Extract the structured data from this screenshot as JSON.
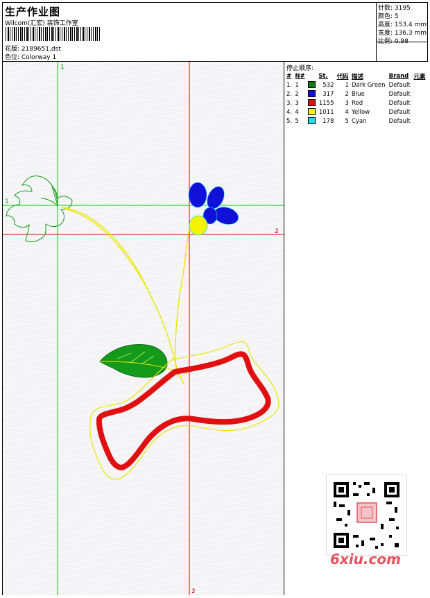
{
  "header": {
    "title": "生产作业图",
    "company": "Wilcom(汇宏) 装饰工作室",
    "design_label": "花版: 2189651.dst",
    "colorway_label": "色位: Colorway 1"
  },
  "stats": {
    "stitches": "针数: 3195",
    "colors": "颜色: 5",
    "height": "高度: 153.4 mm",
    "width": "宽度: 136.3 mm",
    "scale": "比例: 0.98"
  },
  "stop_sequence": {
    "title": "停止顺序:",
    "columns": [
      "#",
      "N#",
      "St.",
      "代码",
      "描述",
      "Brand",
      "元素"
    ],
    "rows": [
      {
        "idx": "1.",
        "n": "1",
        "color": "#0e7c12",
        "st": "532",
        "code": "1",
        "desc": "Dark Green",
        "brand": "Default"
      },
      {
        "idx": "2.",
        "n": "2",
        "color": "#1010d8",
        "st": "317",
        "code": "2",
        "desc": "Blue",
        "brand": "Default"
      },
      {
        "idx": "3.",
        "n": "3",
        "color": "#e01010",
        "st": "1155",
        "code": "3",
        "desc": "Red",
        "brand": "Default"
      },
      {
        "idx": "4.",
        "n": "4",
        "color": "#f4f400",
        "st": "1011",
        "code": "4",
        "desc": "Yellow",
        "brand": "Default"
      },
      {
        "idx": "5.",
        "n": "5",
        "color": "#20e0e8",
        "st": "178",
        "code": "5",
        "desc": "Cyan",
        "brand": "Default"
      }
    ]
  },
  "guides": {
    "v1": "1",
    "v2": "2",
    "h1": "1",
    "h2": "2"
  },
  "watermark": "6xiu.com",
  "colors": {
    "guide_green": "#00cc00",
    "guide_red": "#dd0000"
  }
}
